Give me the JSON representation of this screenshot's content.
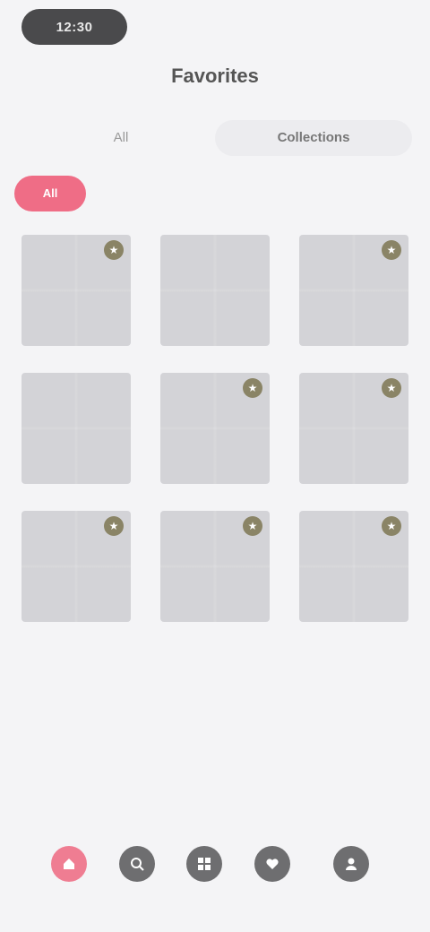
{
  "status_bar": {
    "time": "12:30"
  },
  "header": {
    "title": "Favorites"
  },
  "segments": [
    {
      "label": "All"
    },
    {
      "label": "Collections"
    }
  ],
  "chips": [
    {
      "label": "All",
      "active": true
    },
    {
      "label": ""
    },
    {
      "label": ""
    },
    {
      "label": ""
    },
    {
      "label": ""
    }
  ],
  "grid": {
    "tiles": [
      {
        "badge_icon": "star-icon"
      },
      {
        "badge_icon": ""
      },
      {
        "badge_icon": "star-icon"
      },
      {
        "badge_icon": ""
      },
      {
        "badge_icon": "star-icon"
      },
      {
        "badge_icon": "star-icon"
      },
      {
        "badge_icon": "star-icon"
      },
      {
        "badge_icon": "star-icon"
      },
      {
        "badge_icon": "star-icon"
      }
    ]
  },
  "bottom_nav": {
    "items": [
      {
        "icon": "home-icon",
        "active": true
      },
      {
        "icon": "search-icon",
        "active": false
      },
      {
        "icon": "grid-icon",
        "active": false
      },
      {
        "icon": "heart-icon",
        "active": false
      },
      {
        "icon": "profile-icon",
        "active": false
      }
    ]
  },
  "colors": {
    "accent": "#ef6d86",
    "tile": "#d3d3d7",
    "background": "#f4f4f6",
    "nav_inactive": "#6e6e70"
  }
}
